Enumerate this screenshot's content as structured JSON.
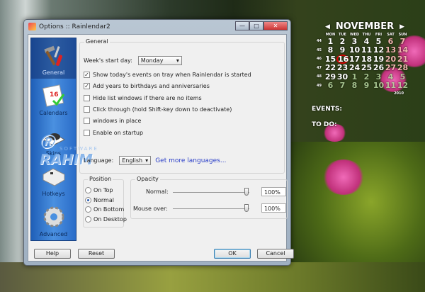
{
  "window": {
    "title": "Options :: Rainlendar2",
    "minimize": "—",
    "maximize": "□",
    "close": "✕"
  },
  "sidebar": {
    "items": [
      {
        "label": "General",
        "icon": "tools-icon"
      },
      {
        "label": "Calendars",
        "icon": "calendar-icon"
      },
      {
        "label": "Skins",
        "icon": "skins-icon"
      },
      {
        "label": "Hotkeys",
        "icon": "key-icon"
      },
      {
        "label": "Advanced",
        "icon": "gear-icon"
      }
    ]
  },
  "watermark": {
    "text": "RAHIM",
    "sub": "SOFTWARE"
  },
  "general": {
    "title": "General",
    "week_start_label": "Week's start day:",
    "week_start_value": "Monday",
    "options": [
      {
        "label": "Show today's events on tray when Rainlendar is started",
        "checked": true
      },
      {
        "label": "Add years to birthdays and anniversaries",
        "checked": true
      },
      {
        "label": "Hide list windows if there are no items",
        "checked": false
      },
      {
        "label": "Click through (hold Shift-key down to deactivate)",
        "checked": false
      },
      {
        "label": "windows in place",
        "checked": false
      },
      {
        "label": "Enable on startup",
        "checked": false
      }
    ],
    "language_label": "Language:",
    "language_value": "English",
    "more_languages": "Get more languages..."
  },
  "position": {
    "title": "Position",
    "options": [
      "On Top",
      "Normal",
      "On Bottom",
      "On Desktop"
    ],
    "selected": "Normal"
  },
  "opacity": {
    "title": "Opacity",
    "normal_label": "Normal:",
    "normal_value": "100%",
    "normal_level": 1.0,
    "mouseover_label": "Mouse over:",
    "mouseover_value": "100%",
    "mouseover_level": 1.0
  },
  "buttons": {
    "help": "Help",
    "reset": "Reset",
    "ok": "OK",
    "cancel": "Cancel"
  },
  "calendar": {
    "month": "NOVEMBER",
    "prev": "◀",
    "next": "▶",
    "year": "2010",
    "today": 16,
    "dow": [
      "MON",
      "TUE",
      "WED",
      "THU",
      "FRI",
      "SAT",
      "SUN"
    ],
    "weeks": [
      {
        "n": "44",
        "days": [
          "1",
          "2",
          "3",
          "4",
          "5",
          "6",
          "7"
        ]
      },
      {
        "n": "45",
        "days": [
          "8",
          "9",
          "10",
          "11",
          "12",
          "13",
          "14"
        ]
      },
      {
        "n": "46",
        "days": [
          "15",
          "16",
          "17",
          "18",
          "19",
          "20",
          "21"
        ]
      },
      {
        "n": "47",
        "days": [
          "22",
          "23",
          "24",
          "25",
          "26",
          "27",
          "28"
        ]
      },
      {
        "n": "48",
        "days": [
          "29",
          "30",
          "1",
          "2",
          "3",
          "4",
          "5"
        ]
      },
      {
        "n": "49",
        "days": [
          "6",
          "7",
          "8",
          "9",
          "10",
          "11",
          "12"
        ]
      }
    ],
    "events_label": "EVENTS:",
    "todo_label": "TO DO:"
  },
  "colors": {
    "accent": "#2a6cc8",
    "link": "#2b3fc8",
    "today_ring": "#dd0000"
  }
}
